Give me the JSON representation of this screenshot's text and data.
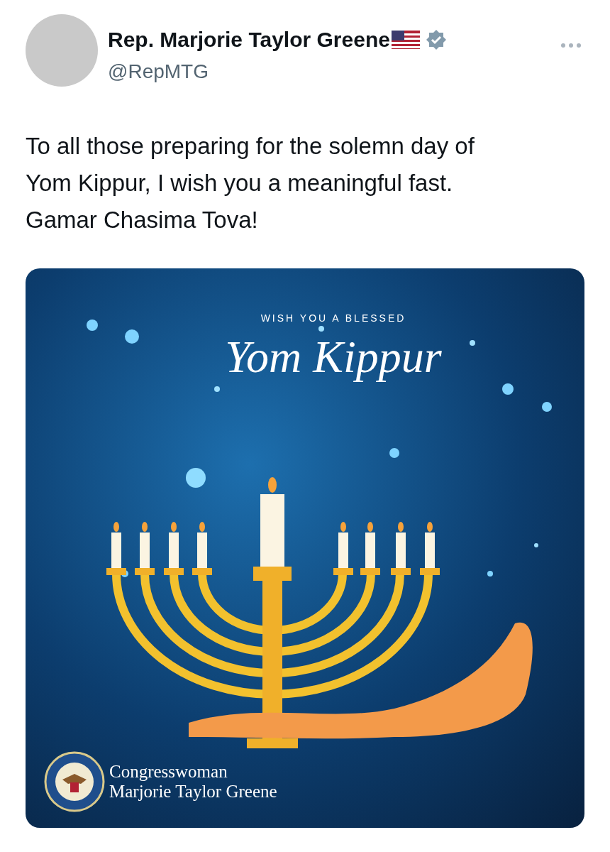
{
  "author": {
    "name": "Rep. Marjorie Taylor Greene",
    "handle": "@RepMTG",
    "verified": true
  },
  "text": "To all those preparing for the solemn day of\nYom Kippur, I wish you a meaningful fast.\nGamar Chasima Tova!",
  "image": {
    "kicker": "WISH YOU A BLESSED",
    "title": "Yom Kippur",
    "signature": [
      "Congresswoman",
      "Marjorie Taylor Greene"
    ]
  }
}
